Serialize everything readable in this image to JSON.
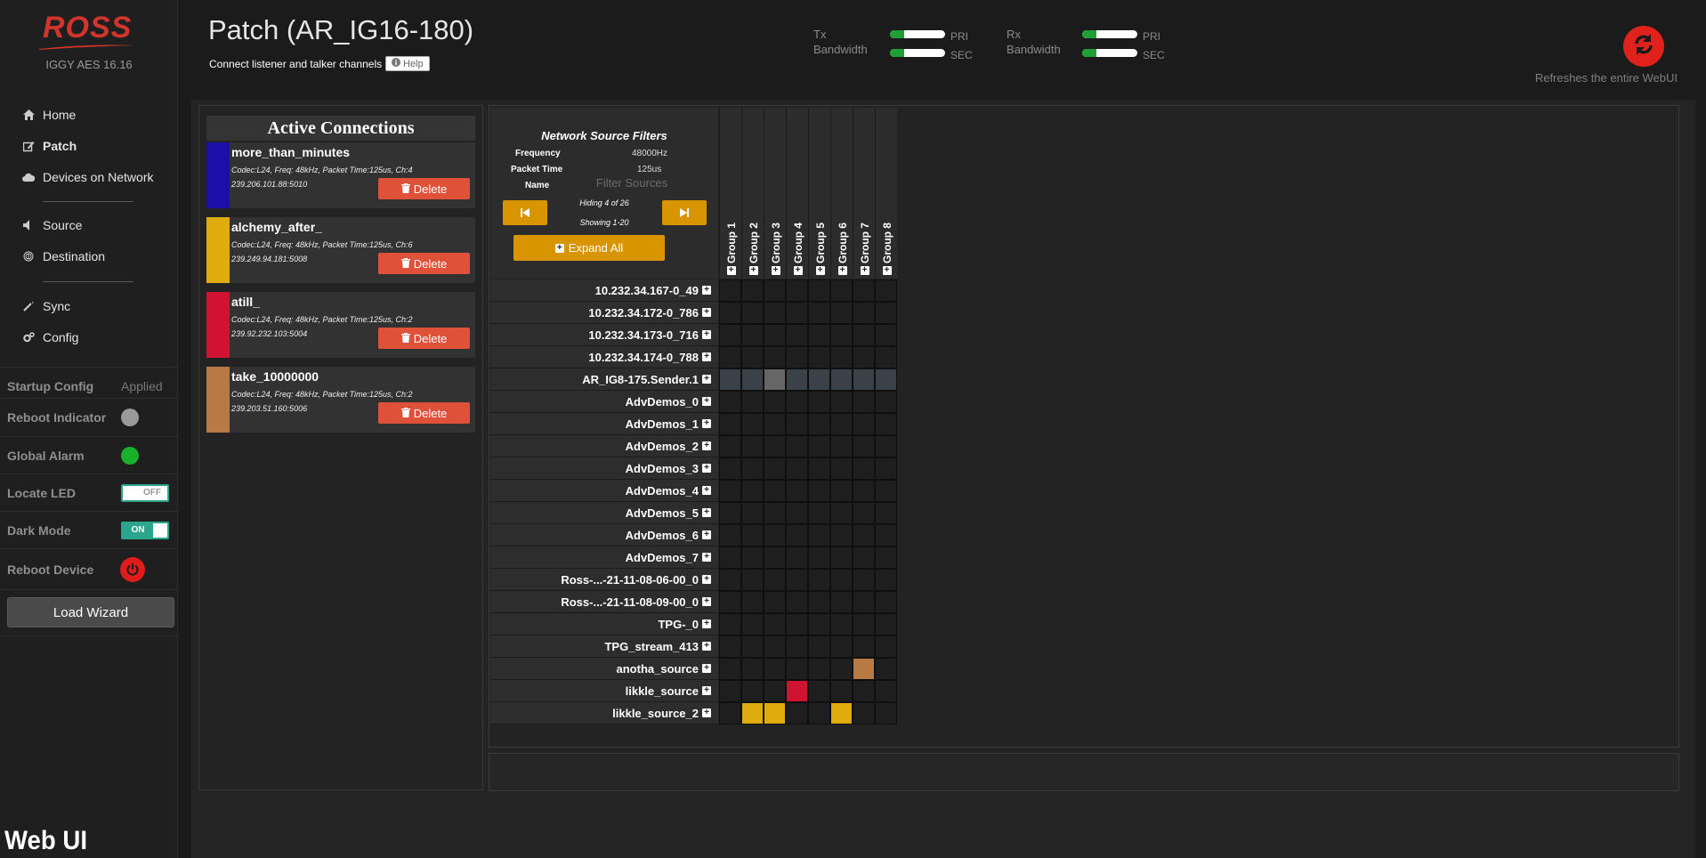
{
  "app": {
    "brand": "ROSS",
    "version": "IGGY AES 16.16",
    "watermark": "Web UI"
  },
  "sidebar": {
    "nav": [
      {
        "label": "Home",
        "icon": "home-icon"
      },
      {
        "label": "Patch",
        "icon": "edit-icon"
      },
      {
        "label": "Devices on Network",
        "icon": "cloud-icon"
      },
      {
        "label": "Source",
        "icon": "speaker-icon"
      },
      {
        "label": "Destination",
        "icon": "fingerprint-icon"
      },
      {
        "label": "Sync",
        "icon": "wand-icon"
      },
      {
        "label": "Config",
        "icon": "cogs-icon"
      }
    ],
    "status": {
      "startup_config": {
        "label": "Startup Config",
        "value": "Applied"
      },
      "reboot_indicator": {
        "label": "Reboot Indicator",
        "color": "#9a9a9a"
      },
      "global_alarm": {
        "label": "Global Alarm",
        "color": "#18b02a"
      },
      "locate_led": {
        "label": "Locate LED",
        "state": "OFF"
      },
      "dark_mode": {
        "label": "Dark Mode",
        "state": "ON"
      },
      "reboot_device": {
        "label": "Reboot Device"
      }
    },
    "load_wizard": "Load Wizard"
  },
  "header": {
    "title": "Patch (AR_IG16-180)",
    "subtitle": "Connect listener and talker channels",
    "help": "Help",
    "tx": {
      "label": "Tx\nBandwidth",
      "pri": "PRI",
      "sec": "SEC",
      "pri_level": 0.25,
      "sec_level": 0.25
    },
    "rx": {
      "label": "Rx\nBandwidth",
      "pri": "PRI",
      "sec": "SEC",
      "pri_level": 0.25,
      "sec_level": 0.25
    },
    "refresh_note": "Refreshes the entire WebUI"
  },
  "connections": {
    "title": "Active Connections",
    "delete_label": "Delete",
    "items": [
      {
        "name": "more_than_minutes",
        "details": "Codec:L24, Freq: 48kHz, Packet Time:125us, Ch:4",
        "address": "239.206.101.88:5010",
        "color": "#1c0ea8"
      },
      {
        "name": "alchemy_after_",
        "details": "Codec:L24, Freq: 48kHz, Packet Time:125us, Ch:6",
        "address": "239.249.94.181:5008",
        "color": "#e0ac0d"
      },
      {
        "name": "atill_",
        "details": "Codec:L24, Freq: 48kHz, Packet Time:125us, Ch:2",
        "address": "239.92.232.103:5004",
        "color": "#d01330"
      },
      {
        "name": "take_10000000",
        "details": "Codec:L24, Freq: 48kHz, Packet Time:125us, Ch:2",
        "address": "239.203.51.160:5006",
        "color": "#b87a45"
      }
    ]
  },
  "filters": {
    "title": "Network Source Filters",
    "frequency_label": "Frequency",
    "frequency": "48000Hz",
    "packet_time_label": "Packet Time",
    "packet_time": "125us",
    "name_label": "Name",
    "name_placeholder": "Filter Sources",
    "hiding": "Hiding 4 of 26",
    "showing": "Showing 1-20",
    "expand_all": "Expand All"
  },
  "matrix": {
    "groups": [
      "Group 1",
      "Group 2",
      "Group 3",
      "Group 4",
      "Group 5",
      "Group 6",
      "Group 7",
      "Group 8"
    ],
    "rows": [
      {
        "label": "10.232.34.167-0_49",
        "cells": [
          "",
          "",
          "",
          "",
          "",
          "",
          "",
          ""
        ]
      },
      {
        "label": "10.232.34.172-0_786",
        "cells": [
          "",
          "",
          "",
          "",
          "",
          "",
          "",
          ""
        ]
      },
      {
        "label": "10.232.34.173-0_716",
        "cells": [
          "",
          "",
          "",
          "",
          "",
          "",
          "",
          ""
        ]
      },
      {
        "label": "10.232.34.174-0_788",
        "cells": [
          "",
          "",
          "",
          "",
          "",
          "",
          "",
          ""
        ]
      },
      {
        "label": "AR_IG8-175.Sender.1",
        "cells": [
          "#3a4149",
          "#3a4149",
          "#666666",
          "#3a4149",
          "#3a4149",
          "#3a4149",
          "#3a4149",
          "#3a4149"
        ]
      },
      {
        "label": "AdvDemos_0",
        "cells": [
          "",
          "",
          "",
          "",
          "",
          "",
          "",
          ""
        ]
      },
      {
        "label": "AdvDemos_1",
        "cells": [
          "",
          "",
          "",
          "",
          "",
          "",
          "",
          ""
        ]
      },
      {
        "label": "AdvDemos_2",
        "cells": [
          "",
          "",
          "",
          "",
          "",
          "",
          "",
          ""
        ]
      },
      {
        "label": "AdvDemos_3",
        "cells": [
          "",
          "",
          "",
          "",
          "",
          "",
          "",
          ""
        ]
      },
      {
        "label": "AdvDemos_4",
        "cells": [
          "",
          "",
          "",
          "",
          "",
          "",
          "",
          ""
        ]
      },
      {
        "label": "AdvDemos_5",
        "cells": [
          "",
          "",
          "",
          "",
          "",
          "",
          "",
          ""
        ]
      },
      {
        "label": "AdvDemos_6",
        "cells": [
          "",
          "",
          "",
          "",
          "",
          "",
          "",
          ""
        ]
      },
      {
        "label": "AdvDemos_7",
        "cells": [
          "",
          "",
          "",
          "",
          "",
          "",
          "",
          ""
        ]
      },
      {
        "label": "Ross-...-21-11-08-06-00_0",
        "cells": [
          "",
          "",
          "",
          "",
          "",
          "",
          "",
          ""
        ]
      },
      {
        "label": "Ross-...-21-11-08-09-00_0",
        "cells": [
          "",
          "",
          "",
          "",
          "",
          "",
          "",
          ""
        ]
      },
      {
        "label": "TPG-_0",
        "cells": [
          "",
          "",
          "",
          "",
          "",
          "",
          "",
          ""
        ]
      },
      {
        "label": "TPG_stream_413",
        "cells": [
          "",
          "",
          "",
          "",
          "",
          "",
          "",
          ""
        ]
      },
      {
        "label": "anotha_source",
        "cells": [
          "",
          "",
          "",
          "",
          "",
          "",
          "#b87a45",
          ""
        ]
      },
      {
        "label": "likkle_source",
        "cells": [
          "",
          "",
          "",
          "#d01330",
          "",
          "",
          "",
          ""
        ]
      },
      {
        "label": "likkle_source_2",
        "cells": [
          "",
          "#e0ac0d",
          "#e0ac0d",
          "",
          "",
          "#e0ac0d",
          "",
          ""
        ]
      }
    ]
  }
}
